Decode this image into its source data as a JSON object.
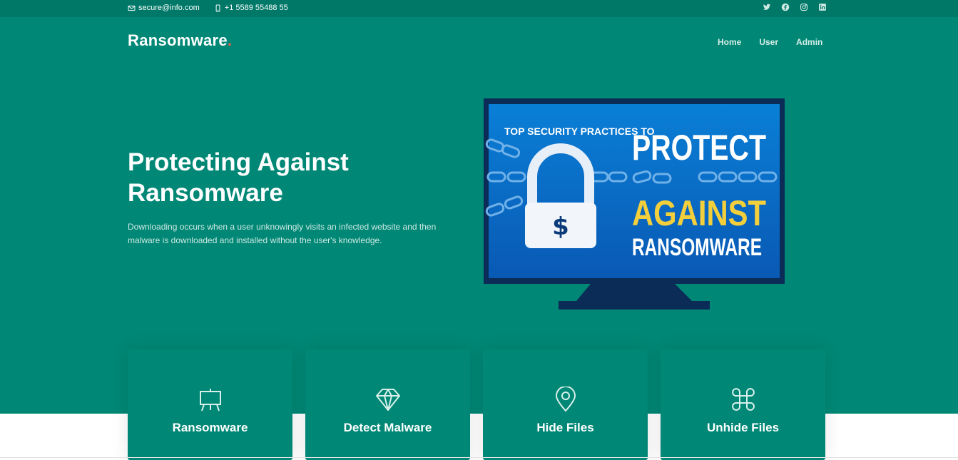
{
  "topbar": {
    "email": "secure@info.com",
    "phone": "+1 5589 55488 55",
    "social": [
      "twitter-icon",
      "facebook-icon",
      "instagram-icon",
      "linkedin-icon"
    ]
  },
  "brand": {
    "name": "Ransomware",
    "dot": "."
  },
  "nav": {
    "home": "Home",
    "user": "User",
    "admin": "Admin"
  },
  "hero": {
    "title": "Protecting Against Ransomware",
    "text": "Downloading occurs when a user unknowingly visits an infected website and then malware is downloaded and installed without the user's knowledge.",
    "image": {
      "line1": "TOP SECURITY PRACTICES TO",
      "line2": "PROTECT",
      "line3": "AGAINST",
      "line4": "RANSOMWARE",
      "symbol": "$"
    }
  },
  "cards": [
    {
      "label": "Ransomware",
      "icon": "easel-icon"
    },
    {
      "label": "Detect Malware",
      "icon": "diamond-icon"
    },
    {
      "label": "Hide Files",
      "icon": "map-pin-icon"
    },
    {
      "label": "Unhide Files",
      "icon": "command-icon"
    }
  ],
  "colors": {
    "hero_bg": "#008775",
    "topbar_bg": "#007868",
    "brand_dot": "#f25f4c",
    "screen_blue": "#0a7fd6",
    "headline_yellow": "#f4cf3c"
  }
}
